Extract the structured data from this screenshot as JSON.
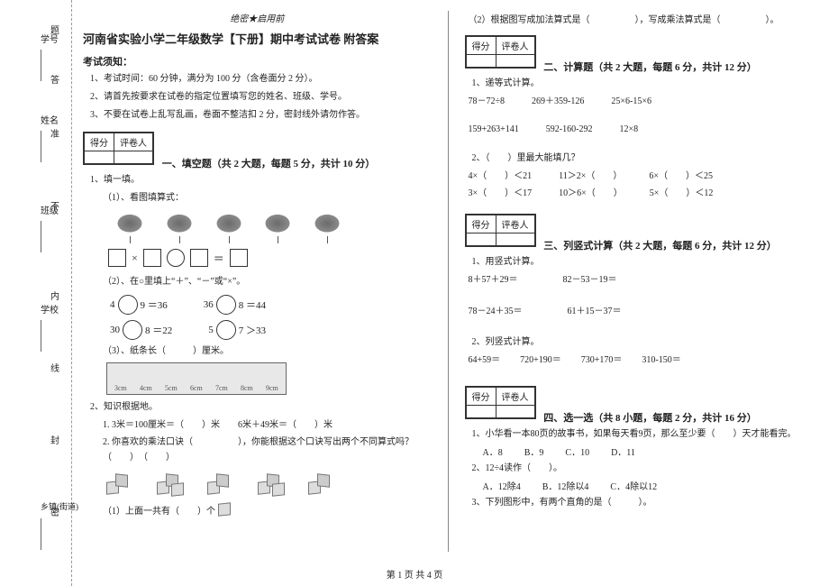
{
  "binding": {
    "labels": [
      "学号",
      "姓名",
      "班级",
      "学校",
      "乡镇(街道)"
    ],
    "vertical_text": [
      "题",
      "答",
      "准",
      "不",
      "内",
      "线",
      "封",
      "密"
    ]
  },
  "header": {
    "secret": "绝密★启用前",
    "title": "河南省实验小学二年级数学【下册】期中考试试卷 附答案",
    "instructions_title": "考试须知：",
    "instructions": [
      "1、考试时间：60 分钟，满分为 100 分（含卷面分 2 分）。",
      "2、请首先按要求在试卷的指定位置填写您的姓名、班级、学号。",
      "3、不要在试卷上乱写乱画，卷面不整洁扣 2 分，密封线外请勿作答。"
    ]
  },
  "score_box": {
    "c1": "得分",
    "c2": "评卷人"
  },
  "sections": {
    "s1": "一、填空题（共 2 大题，每题 5 分，共计 10 分）",
    "s2": "二、计算题（共 2 大题，每题 6 分，共计 12 分）",
    "s3": "三、列竖式计算（共 2 大题，每题 6 分，共计 12 分）",
    "s4": "四、选一选（共 8 小题，每题 2 分，共计 16 分）"
  },
  "q1": {
    "stem": "1、填一填。",
    "sub1": "（1）、看图填算式：",
    "sub2": "（2）、在○里填上“＋”、“－”或“×”。",
    "eqs": {
      "a": "4",
      "a2": "9 ＝36",
      "b": "36",
      "b2": "8 ＝44",
      "c": "30",
      "c2": "8 ＝22",
      "d": "5",
      "d2": "7 ＞33"
    },
    "sub3": "（3）、纸条长（　　　）厘米。",
    "ruler_marks": [
      "3cm",
      "4cm",
      "5cm",
      "6cm",
      "7cm",
      "8cm",
      "9cm"
    ]
  },
  "q2": {
    "stem": "2、知识根据地。",
    "items": [
      "1. 3米＝100厘米＝（　　）米　　6米＋49米＝（　　）米",
      "2. 你喜欢的乘法口诀（　　　　　），你能根据这个口诀写出两个不同算式吗？（　　）　（　　）"
    ],
    "cubes_q": "（1）上面一共有（　　）个"
  },
  "right_top": {
    "line": "（2）根据图写成加法算式是（　　　　　），写成乘法算式是（　　　　　）。"
  },
  "calc": {
    "stem": "1、递等式计算。",
    "rows": [
      [
        "78－72÷8",
        "269＋359-126",
        "25×6-15×6"
      ],
      [
        "159+263+141",
        "592-160-292",
        "12×8"
      ]
    ],
    "stem2": "2、（　　）里最大能填几？",
    "rows2": [
      [
        "4×（　　）＜21",
        "11＞2×（　　）",
        "6×（　　）＜25"
      ],
      [
        "3×（　　）＜17",
        "10＞6×（　　）",
        "5×（　　）＜12"
      ]
    ]
  },
  "vertical": {
    "stem": "1、用竖式计算。",
    "rows": [
      [
        "8＋57＋29＝",
        "82－53－19＝"
      ],
      [
        "78－24＋35＝",
        "61＋15－37＝"
      ]
    ],
    "stem2": "2、列竖式计算。",
    "rows2": [
      [
        "64+59＝",
        "720+190＝",
        "730+170＝",
        "310-150＝"
      ]
    ]
  },
  "choose": {
    "q1": "1、小华看一本80页的故事书，如果每天看9页，那么至少要（　　）天才能看完。",
    "q1_opts": [
      "A．8",
      "B．9",
      "C．10",
      "D．11"
    ],
    "q2": "2、12÷4读作（　　）。",
    "q2_opts": [
      "A．12除4",
      "B．12除以4",
      "C．4除以12"
    ],
    "q3": "3、下列图形中，有两个直角的是（　　　）。"
  },
  "footer": "第 1 页 共 4 页"
}
